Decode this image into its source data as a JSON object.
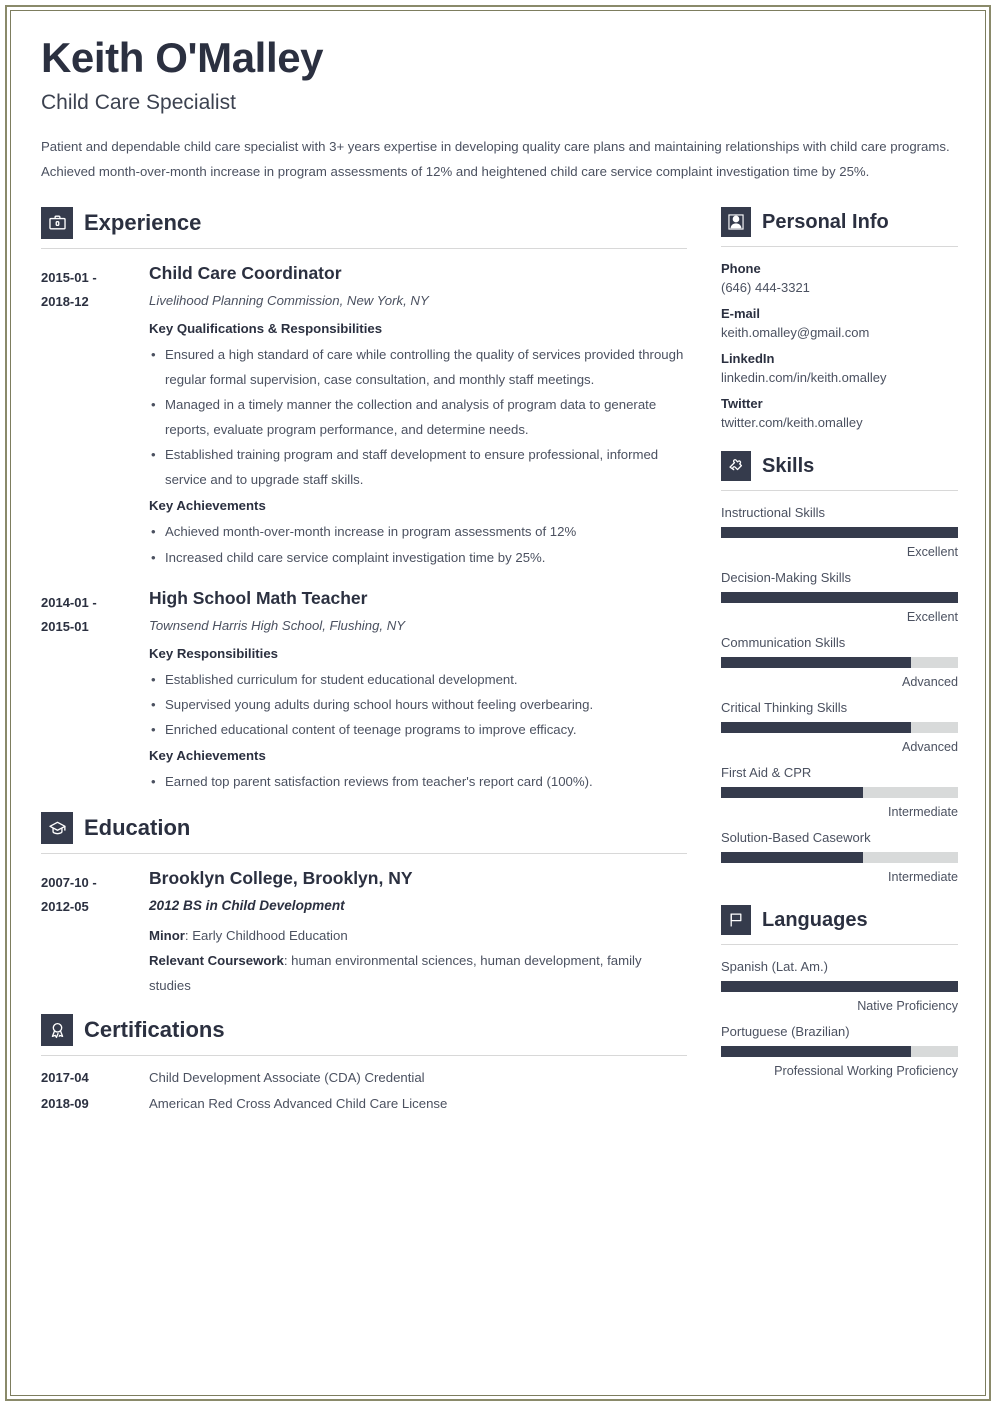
{
  "header": {
    "name": "Keith O'Malley",
    "job_title": "Child Care Specialist",
    "summary": "Patient and dependable child care specialist with 3+ years expertise in developing quality care plans and maintaining relationships with child care programs. Achieved month-over-month increase in program assessments of 12% and heightened child care service complaint investigation time by 25%."
  },
  "theme": {
    "dark": "#353b4c",
    "text": "#2b3040",
    "body_text": "#4b5160",
    "track": "#d8dada",
    "frame": "#8a8a6a"
  },
  "sections": {
    "experience": {
      "title": "Experience",
      "icon": "briefcase-icon"
    },
    "education": {
      "title": "Education",
      "icon": "graduation-cap-icon"
    },
    "certifications": {
      "title": "Certifications",
      "icon": "award-ribbon-icon"
    },
    "personal_info": {
      "title": "Personal Info",
      "icon": "person-icon"
    },
    "skills": {
      "title": "Skills",
      "icon": "puzzle-piece-icon"
    },
    "languages": {
      "title": "Languages",
      "icon": "flag-icon"
    }
  },
  "experience": [
    {
      "dates": "2015-01 - 2018-12",
      "date_start": "2015-01 -",
      "date_end": "2018-12",
      "title": "Child Care Coordinator",
      "org": "Livelihood Planning Commission, New York, NY",
      "groups": [
        {
          "label": "Key Qualifications & Responsibilities",
          "bullets": [
            "Ensured a high standard of care while controlling the quality of services provided through regular formal supervision, case consultation, and monthly staff meetings.",
            "Managed in a timely manner the collection and analysis of program data to generate reports, evaluate program performance, and determine needs.",
            "Established training program and staff development to ensure professional, informed service and to upgrade staff skills."
          ]
        },
        {
          "label": "Key Achievements",
          "bullets": [
            "Achieved month-over-month increase in program assessments of 12%",
            "Increased child care service complaint investigation time by 25%."
          ]
        }
      ]
    },
    {
      "dates": "2014-01 - 2015-01",
      "date_start": "2014-01 -",
      "date_end": "2015-01",
      "title": "High School Math Teacher",
      "org": "Townsend Harris High School, Flushing, NY",
      "groups": [
        {
          "label": "Key Responsibilities",
          "bullets": [
            "Established curriculum for student educational development.",
            "Supervised young adults during school hours without feeling overbearing.",
            "Enriched educational content of teenage programs to improve efficacy."
          ]
        },
        {
          "label": "Key Achievements",
          "bullets": [
            "Earned top parent satisfaction reviews from teacher's report card (100%)."
          ]
        }
      ]
    }
  ],
  "education": [
    {
      "date_start": "2007-10 -",
      "date_end": "2012-05",
      "school": "Brooklyn College, Brooklyn, NY",
      "degree": "2012 BS in Child Development",
      "minor_label": "Minor",
      "minor_value": ": Early Childhood Education",
      "coursework_label": "Relevant Coursework",
      "coursework_value": ": human environmental sciences, human development, family studies"
    }
  ],
  "certifications": [
    {
      "date": "2017-04",
      "name": "Child Development Associate (CDA) Credential"
    },
    {
      "date": "2018-09",
      "name": "American Red Cross Advanced Child Care License"
    }
  ],
  "personal_info": [
    {
      "label": "Phone",
      "value": "(646) 444-3321"
    },
    {
      "label": "E-mail",
      "value": "keith.omalley@gmail.com"
    },
    {
      "label": "LinkedIn",
      "value": "linkedin.com/in/keith.omalley"
    },
    {
      "label": "Twitter",
      "value": "twitter.com/keith.omalley"
    }
  ],
  "skills": [
    {
      "name": "Instructional Skills",
      "level": "Excellent",
      "percent": 100
    },
    {
      "name": "Decision-Making Skills",
      "level": "Excellent",
      "percent": 100
    },
    {
      "name": "Communication Skills",
      "level": "Advanced",
      "percent": 80
    },
    {
      "name": "Critical Thinking Skills",
      "level": "Advanced",
      "percent": 80
    },
    {
      "name": "First Aid & CPR",
      "level": "Intermediate",
      "percent": 60
    },
    {
      "name": "Solution-Based Casework",
      "level": "Intermediate",
      "percent": 60
    }
  ],
  "languages": [
    {
      "name": "Spanish (Lat. Am.)",
      "level": "Native Proficiency",
      "percent": 100
    },
    {
      "name": "Portuguese (Brazilian)",
      "level": "Professional Working Proficiency",
      "percent": 80
    }
  ]
}
